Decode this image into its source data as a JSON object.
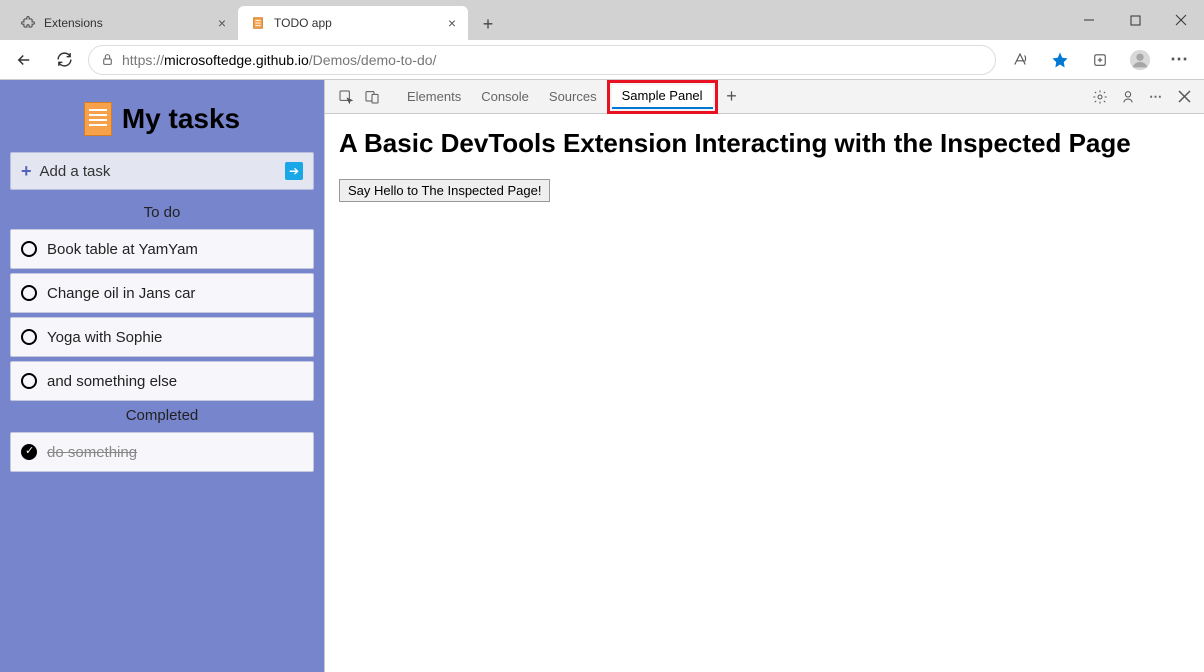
{
  "browser": {
    "tabs": [
      {
        "title": "Extensions",
        "active": false,
        "icon": "extension"
      },
      {
        "title": "TODO app",
        "active": true,
        "icon": "note"
      }
    ],
    "url_protocol": "https://",
    "url_host": "microsoftedge.github.io",
    "url_path": "/Demos/demo-to-do/"
  },
  "app": {
    "heading": "My tasks",
    "add_task_label": "Add a task",
    "sections": {
      "todo_label": "To do",
      "completed_label": "Completed"
    },
    "todo": [
      {
        "text": "Book table at YamYam"
      },
      {
        "text": "Change oil in Jans car"
      },
      {
        "text": "Yoga with Sophie"
      },
      {
        "text": "and something else"
      }
    ],
    "completed": [
      {
        "text": "do something"
      }
    ]
  },
  "devtools": {
    "tabs": [
      "Elements",
      "Console",
      "Sources",
      "Sample Panel"
    ],
    "active_tab": "Sample Panel",
    "panel_heading": "A Basic DevTools Extension Interacting with the Inspected Page",
    "button_label": "Say Hello to The Inspected Page!"
  }
}
